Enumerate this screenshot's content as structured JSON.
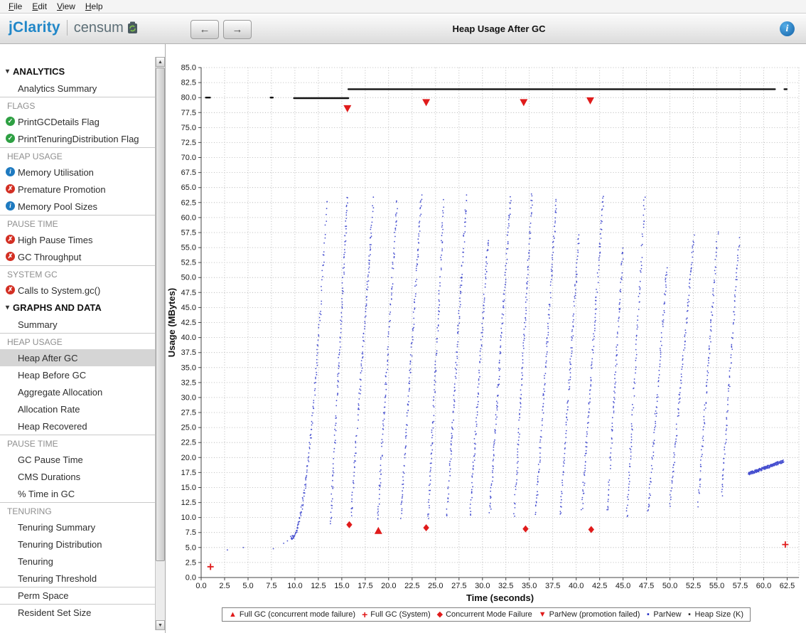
{
  "menubar": {
    "items": [
      "File",
      "Edit",
      "View",
      "Help"
    ]
  },
  "header": {
    "brand_name": "jClarity",
    "product_name": "censum",
    "title": "Heap Usage After GC"
  },
  "icons": {
    "back_arrow": "←",
    "forward_arrow": "→",
    "info": "i",
    "group_expanded": "▾",
    "check": "✓",
    "cross": "✗",
    "scroll_up": "▲",
    "scroll_down": "▼"
  },
  "sidebar": {
    "rows": [
      {
        "type": "group",
        "label": "ANALYTICS"
      },
      {
        "type": "item",
        "label": "Analytics Summary"
      },
      {
        "type": "section",
        "label": "FLAGS"
      },
      {
        "type": "item",
        "label": "PrintGCDetails Flag",
        "icon": "ok"
      },
      {
        "type": "item",
        "label": "PrintTenuringDistribution Flag",
        "icon": "ok"
      },
      {
        "type": "section",
        "label": "HEAP USAGE"
      },
      {
        "type": "item",
        "label": "Memory Utilisation",
        "icon": "info"
      },
      {
        "type": "item",
        "label": "Premature Promotion",
        "icon": "error"
      },
      {
        "type": "item",
        "label": "Memory Pool Sizes",
        "icon": "info"
      },
      {
        "type": "section",
        "label": "PAUSE TIME"
      },
      {
        "type": "item",
        "label": "High Pause Times",
        "icon": "error"
      },
      {
        "type": "item",
        "label": "GC Throughput",
        "icon": "error"
      },
      {
        "type": "section",
        "label": "SYSTEM GC"
      },
      {
        "type": "item",
        "label": "Calls to System.gc()",
        "icon": "error"
      },
      {
        "type": "group",
        "label": "GRAPHS AND DATA"
      },
      {
        "type": "item",
        "label": "Summary"
      },
      {
        "type": "section",
        "label": "HEAP USAGE"
      },
      {
        "type": "item",
        "label": "Heap After GC",
        "selected": true
      },
      {
        "type": "item",
        "label": "Heap Before GC"
      },
      {
        "type": "item",
        "label": "Aggregate Allocation"
      },
      {
        "type": "item",
        "label": "Allocation Rate"
      },
      {
        "type": "item",
        "label": "Heap Recovered"
      },
      {
        "type": "section",
        "label": "PAUSE TIME"
      },
      {
        "type": "item",
        "label": "GC Pause Time"
      },
      {
        "type": "item",
        "label": "CMS Durations"
      },
      {
        "type": "item",
        "label": "% Time in GC"
      },
      {
        "type": "section",
        "label": "TENURING"
      },
      {
        "type": "item",
        "label": "Tenuring Summary"
      },
      {
        "type": "item",
        "label": "Tenuring Distribution"
      },
      {
        "type": "item",
        "label": "Tenuring"
      },
      {
        "type": "item",
        "label": "Tenuring Threshold"
      },
      {
        "type": "item",
        "label": "Perm Space",
        "divider": true
      },
      {
        "type": "item",
        "label": "Resident Set Size",
        "divider": true
      }
    ]
  },
  "chart_data": {
    "type": "scatter",
    "title": "Heap Usage After GC",
    "xlabel": "Time (seconds)",
    "ylabel": "Usage (MBytes)",
    "xlim": [
      0,
      63.75
    ],
    "ylim": [
      0,
      85
    ],
    "xtick_step": 2.5,
    "xtick_max": 62.5,
    "ytick_step": 2.5,
    "grid": true,
    "series": [
      {
        "name": "ParNew",
        "type": "scatter-ramps",
        "color": "#2b36c8",
        "marker": "dot",
        "ramps": [
          {
            "x1": 9.6,
            "y1": 6.6,
            "x2": 13.4,
            "y2": 63.0,
            "n": 170,
            "curve": 2.0
          },
          {
            "x1": 13.8,
            "y1": 9.0,
            "x2": 15.6,
            "y2": 63.5,
            "n": 120
          },
          {
            "x1": 16.0,
            "y1": 10.5,
            "x2": 18.4,
            "y2": 63.5,
            "n": 140
          },
          {
            "x1": 18.8,
            "y1": 9.0,
            "x2": 20.9,
            "y2": 63.0,
            "n": 130
          },
          {
            "x1": 21.3,
            "y1": 10.0,
            "x2": 23.5,
            "y2": 63.5,
            "n": 140
          },
          {
            "x1": 24.2,
            "y1": 9.5,
            "x2": 25.9,
            "y2": 63.0,
            "n": 115
          },
          {
            "x1": 26.2,
            "y1": 10.0,
            "x2": 28.3,
            "y2": 63.5,
            "n": 140
          },
          {
            "x1": 28.7,
            "y1": 10.5,
            "x2": 30.6,
            "y2": 56.5,
            "n": 115
          },
          {
            "x1": 30.8,
            "y1": 11.0,
            "x2": 33.0,
            "y2": 63.5,
            "n": 140
          },
          {
            "x1": 33.4,
            "y1": 10.0,
            "x2": 35.3,
            "y2": 64.0,
            "n": 125
          },
          {
            "x1": 35.7,
            "y1": 10.5,
            "x2": 37.9,
            "y2": 63.0,
            "n": 135
          },
          {
            "x1": 38.3,
            "y1": 10.0,
            "x2": 40.3,
            "y2": 57.0,
            "n": 115
          },
          {
            "x1": 40.6,
            "y1": 11.0,
            "x2": 42.9,
            "y2": 63.5,
            "n": 135
          },
          {
            "x1": 43.3,
            "y1": 10.5,
            "x2": 45.0,
            "y2": 55.0,
            "n": 105
          },
          {
            "x1": 45.4,
            "y1": 10.0,
            "x2": 47.3,
            "y2": 63.0,
            "n": 115
          },
          {
            "x1": 47.7,
            "y1": 11.0,
            "x2": 49.7,
            "y2": 52.0,
            "n": 105
          },
          {
            "x1": 50.0,
            "y1": 12.0,
            "x2": 52.6,
            "y2": 57.5,
            "n": 115
          },
          {
            "x1": 53.0,
            "y1": 12.0,
            "x2": 55.1,
            "y2": 57.5,
            "n": 105
          },
          {
            "x1": 55.5,
            "y1": 13.0,
            "x2": 57.4,
            "y2": 57.0,
            "n": 100
          },
          {
            "x1": 58.4,
            "y1": 17.3,
            "x2": 62.1,
            "y2": 19.4,
            "n": 260,
            "jy": 0.25,
            "dense": true
          }
        ],
        "extra_points": [
          [
            2.8,
            4.6
          ],
          [
            4.5,
            5.0
          ],
          [
            7.7,
            4.8
          ],
          [
            8.8,
            5.7
          ],
          [
            9.2,
            6.1
          ]
        ]
      },
      {
        "name": "Heap Size (K)",
        "type": "line-segments",
        "color": "#111111",
        "marker": "dot",
        "segments": [
          {
            "x1": 0.5,
            "x2": 0.95,
            "y": 80.0
          },
          {
            "x1": 7.4,
            "x2": 7.65,
            "y": 80.0
          },
          {
            "x1": 9.9,
            "x2": 15.7,
            "y": 79.9
          },
          {
            "x1": 15.7,
            "x2": 61.2,
            "y": 81.4
          },
          {
            "x1": 62.2,
            "x2": 62.45,
            "y": 81.4
          }
        ]
      },
      {
        "name": "ParNew (promotion failed)",
        "type": "markers",
        "marker": "triangle-down",
        "color": "#e01b1b",
        "points": [
          [
            15.6,
            78.2
          ],
          [
            24.0,
            79.2
          ],
          [
            34.4,
            79.2
          ],
          [
            41.5,
            79.5
          ]
        ]
      },
      {
        "name": "Concurrent Mode Failure",
        "type": "markers",
        "marker": "diamond",
        "color": "#e01b1b",
        "points": [
          [
            15.8,
            8.8
          ],
          [
            24.0,
            8.3
          ],
          [
            34.6,
            8.1
          ],
          [
            41.6,
            8.0
          ]
        ]
      },
      {
        "name": "Full GC (concurrent mode failure)",
        "type": "markers",
        "marker": "triangle-up",
        "color": "#e01b1b",
        "points": [
          [
            18.9,
            7.8
          ]
        ]
      },
      {
        "name": "Full GC (System)",
        "type": "markers",
        "marker": "plus",
        "color": "#e01b1b",
        "points": [
          [
            1.0,
            1.8
          ],
          [
            62.3,
            5.5
          ]
        ]
      }
    ]
  },
  "legend": {
    "items": [
      {
        "glyph": "triangle-up",
        "color": "#e01b1b",
        "label": "Full GC (concurrent mode failure)"
      },
      {
        "glyph": "plus",
        "color": "#e01b1b",
        "label": "Full GC (System)"
      },
      {
        "glyph": "diamond",
        "color": "#e01b1b",
        "label": "Concurrent Mode Failure"
      },
      {
        "glyph": "triangle-down",
        "color": "#e01b1b",
        "label": "ParNew (promotion failed)"
      },
      {
        "glyph": "dot",
        "color": "#2b36c8",
        "label": "ParNew"
      },
      {
        "glyph": "dot",
        "color": "#333333",
        "label": "Heap Size (K)"
      }
    ]
  }
}
